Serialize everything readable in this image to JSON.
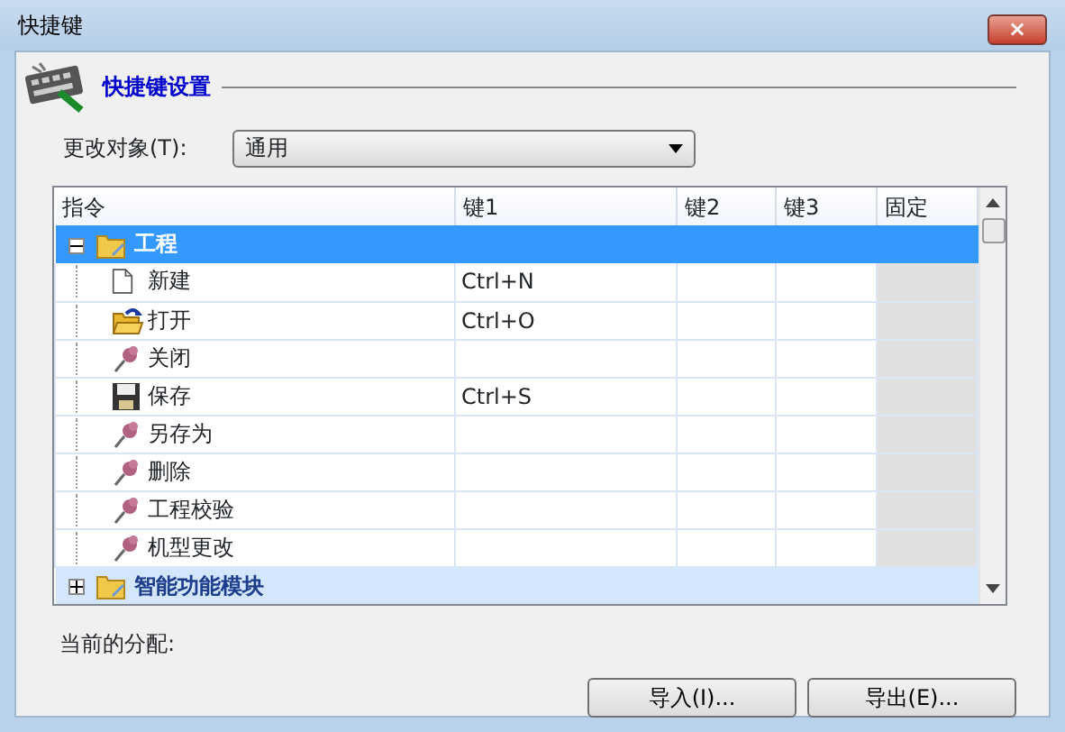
{
  "window": {
    "title": "快捷键",
    "close": "×"
  },
  "section": {
    "title": "快捷键设置"
  },
  "target": {
    "label": "更改对象(T):",
    "value": "通用"
  },
  "table": {
    "columns": [
      "指令",
      "键1",
      "键2",
      "键3",
      "固定"
    ],
    "rows": [
      {
        "label": "工程",
        "expanded": true,
        "selected": true,
        "children": [
          {
            "label": "新建",
            "kind": "new",
            "key1": "Ctrl+N"
          },
          {
            "label": "打开",
            "kind": "open",
            "key1": "Ctrl+O"
          },
          {
            "label": "关闭",
            "kind": "pin"
          },
          {
            "label": "保存",
            "kind": "save",
            "key1": "Ctrl+S"
          },
          {
            "label": "另存为",
            "kind": "pin"
          },
          {
            "label": "删除",
            "kind": "pin"
          },
          {
            "label": "工程校验",
            "kind": "pin"
          },
          {
            "label": "机型更改",
            "kind": "pin"
          }
        ]
      },
      {
        "label": "智能功能模块",
        "expanded": false,
        "selected": false,
        "children": []
      }
    ]
  },
  "assignment": {
    "label": "当前的分配:"
  },
  "buttons": [
    "导入(I)...",
    "导出(E)..."
  ]
}
